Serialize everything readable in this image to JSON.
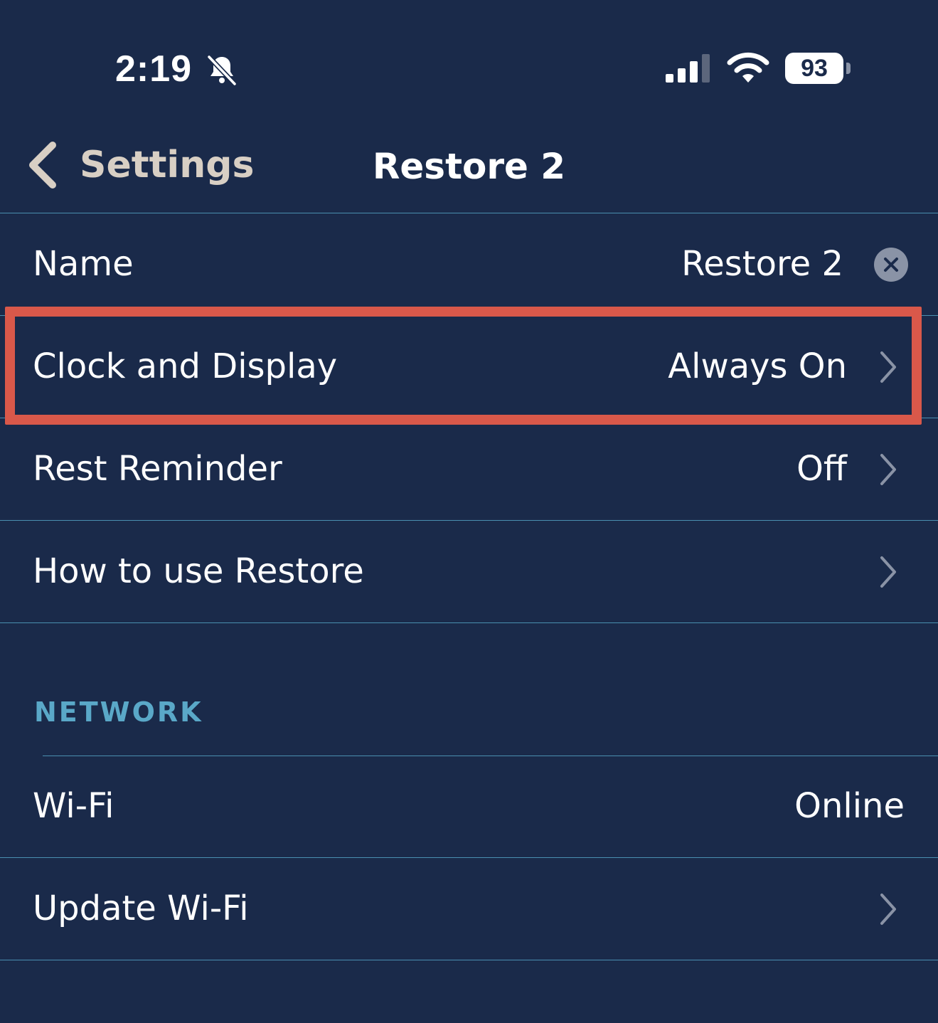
{
  "status_bar": {
    "time": "2:19",
    "battery": "93",
    "icons": [
      "bell-slash-icon",
      "cellular-signal-icon",
      "wifi-icon",
      "battery-icon"
    ]
  },
  "nav": {
    "back_label": "Settings",
    "title": "Restore 2"
  },
  "rows": [
    {
      "label": "Name",
      "value": "Restore 2",
      "accessory": "clear-icon"
    },
    {
      "label": "Clock and Display",
      "value": "Always On",
      "accessory": "chevron-right-icon",
      "highlighted": true
    },
    {
      "label": "Rest Reminder",
      "value": "Off",
      "accessory": "chevron-right-icon"
    },
    {
      "label": "How to use Restore",
      "value": "",
      "accessory": "chevron-right-icon"
    }
  ],
  "network": {
    "header": "NETWORK",
    "rows": [
      {
        "label": "Wi-Fi",
        "value": "Online"
      },
      {
        "label": "Update Wi-Fi",
        "value": "",
        "accessory": "chevron-right-icon"
      }
    ]
  },
  "colors": {
    "background": "#1a2a4a",
    "divider": "#4a8fb0",
    "highlight": "#d9584a",
    "section_header": "#5aa8c8",
    "back_label": "#d8cfc4"
  }
}
